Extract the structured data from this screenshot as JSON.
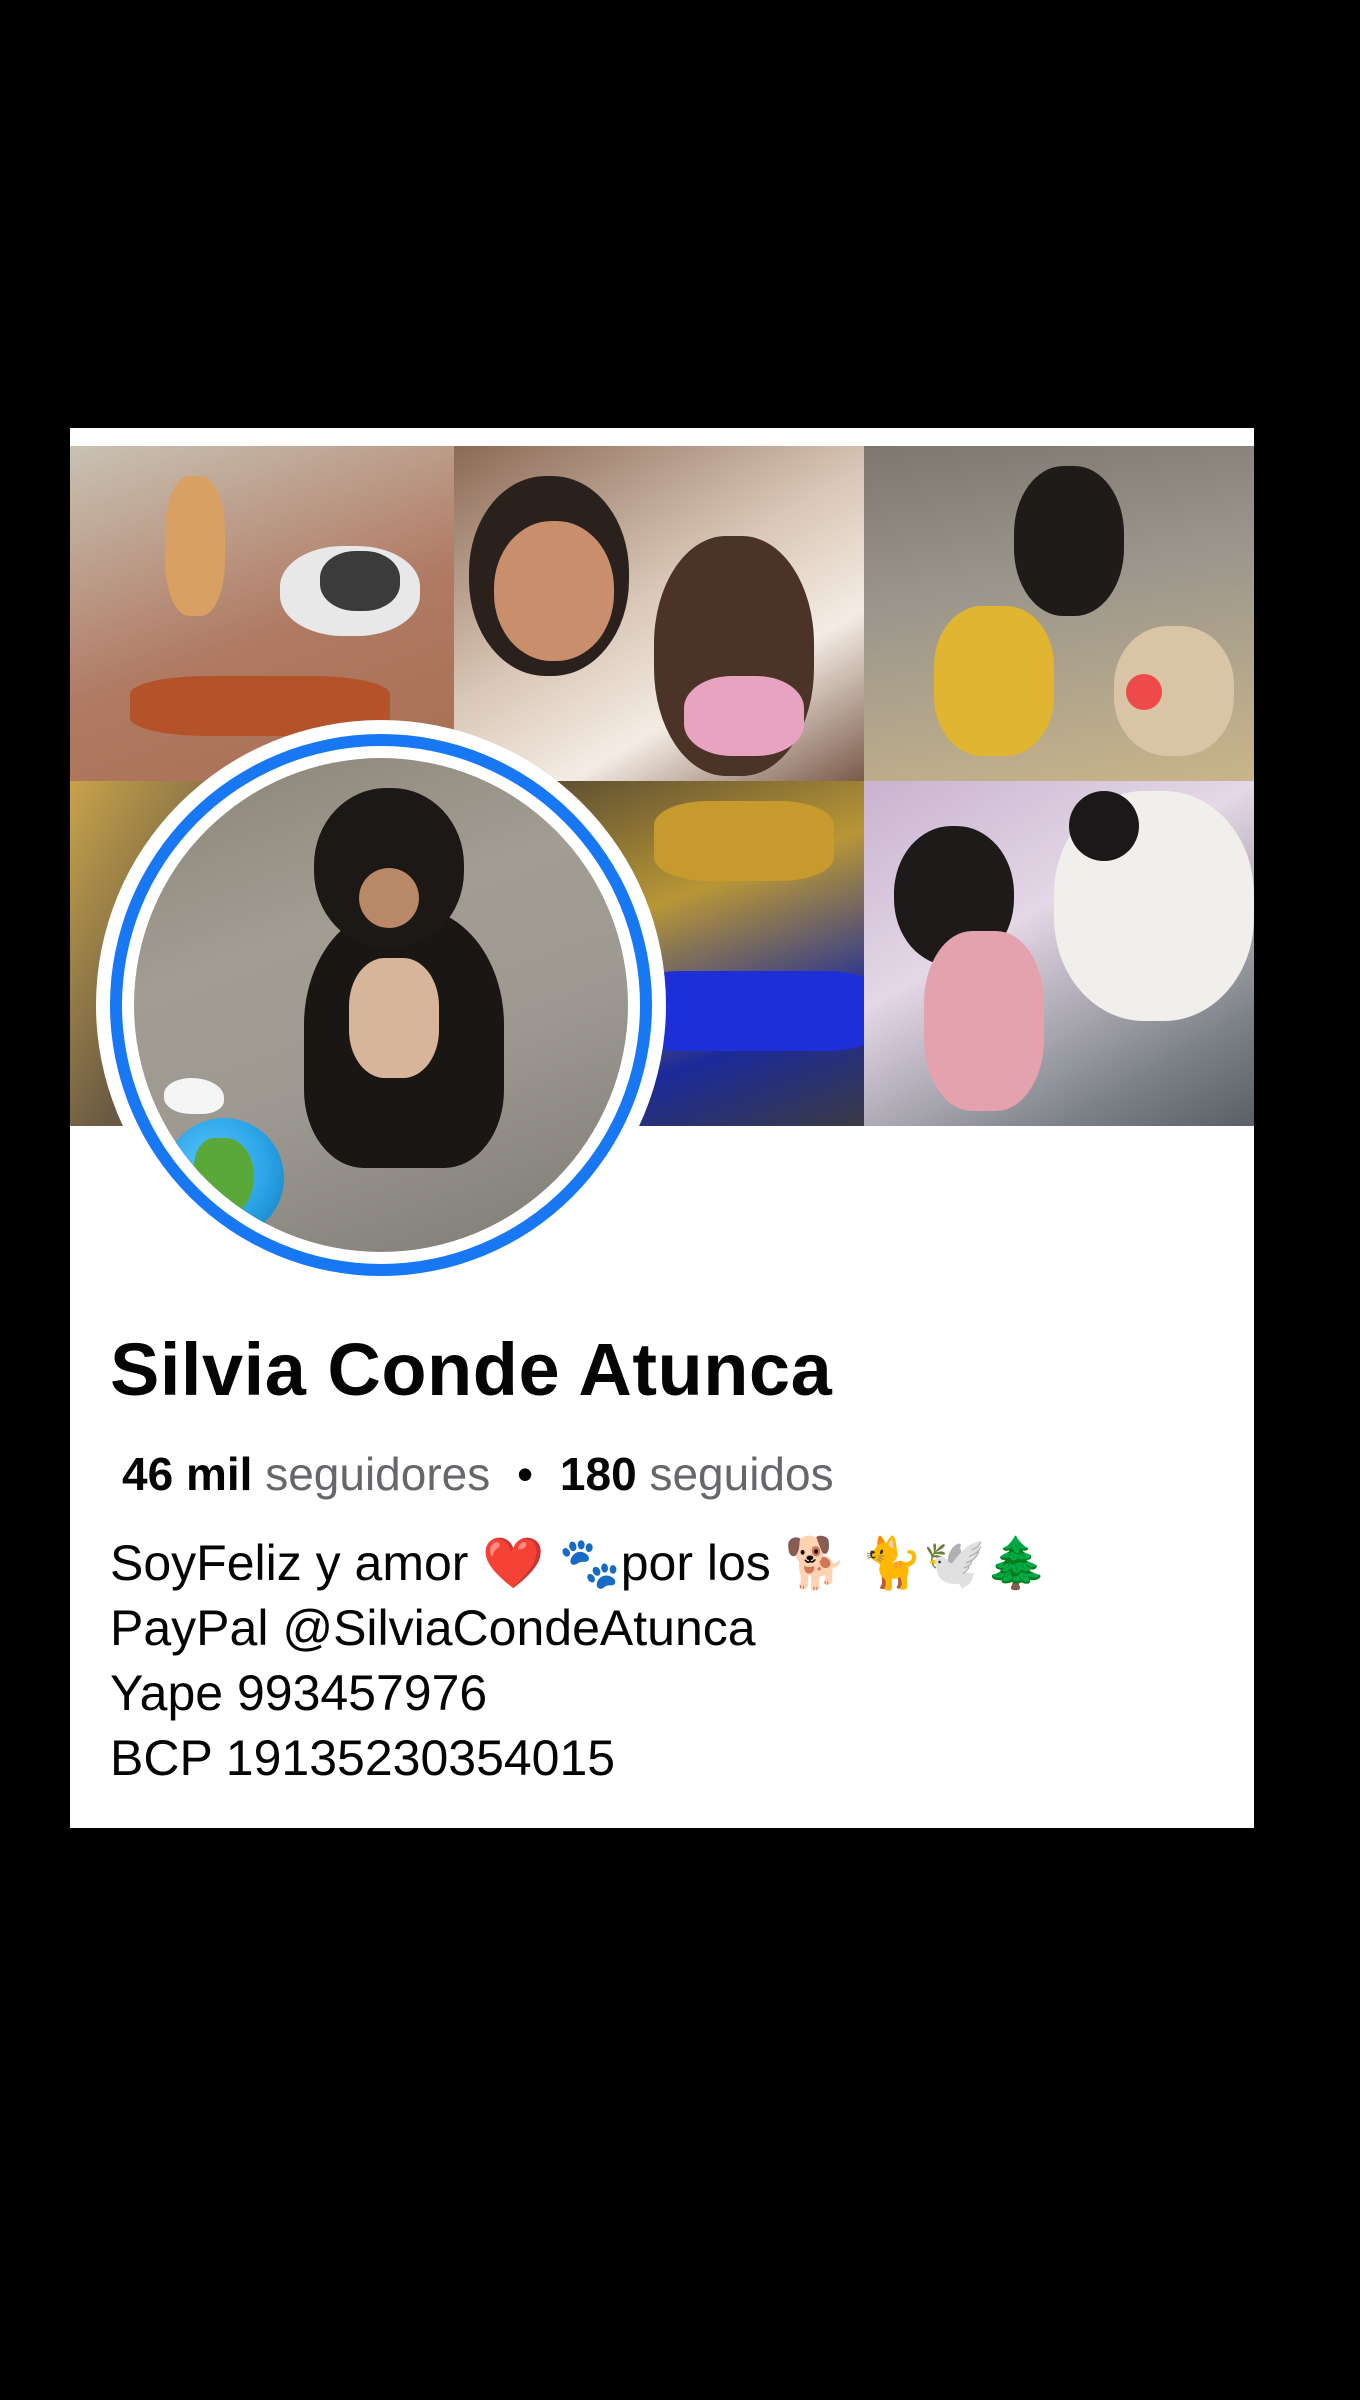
{
  "profile": {
    "name": "Silvia Conde Atunca",
    "followers_count": "46 mil",
    "followers_label": "seguidores",
    "separator": "•",
    "following_count": "180",
    "following_label": "seguidos",
    "bio": [
      "SoyFeliz y amor ❤️ 🐾por los 🐕 🐈🕊️🌲",
      "PayPal @SilviaCondeAtunca",
      "Yape 993457976",
      "BCP 19135230354015"
    ]
  },
  "colors": {
    "avatar_ring": "#1877f2",
    "text_primary": "#050505",
    "text_secondary": "#65676b",
    "background": "#000000",
    "card": "#ffffff"
  }
}
